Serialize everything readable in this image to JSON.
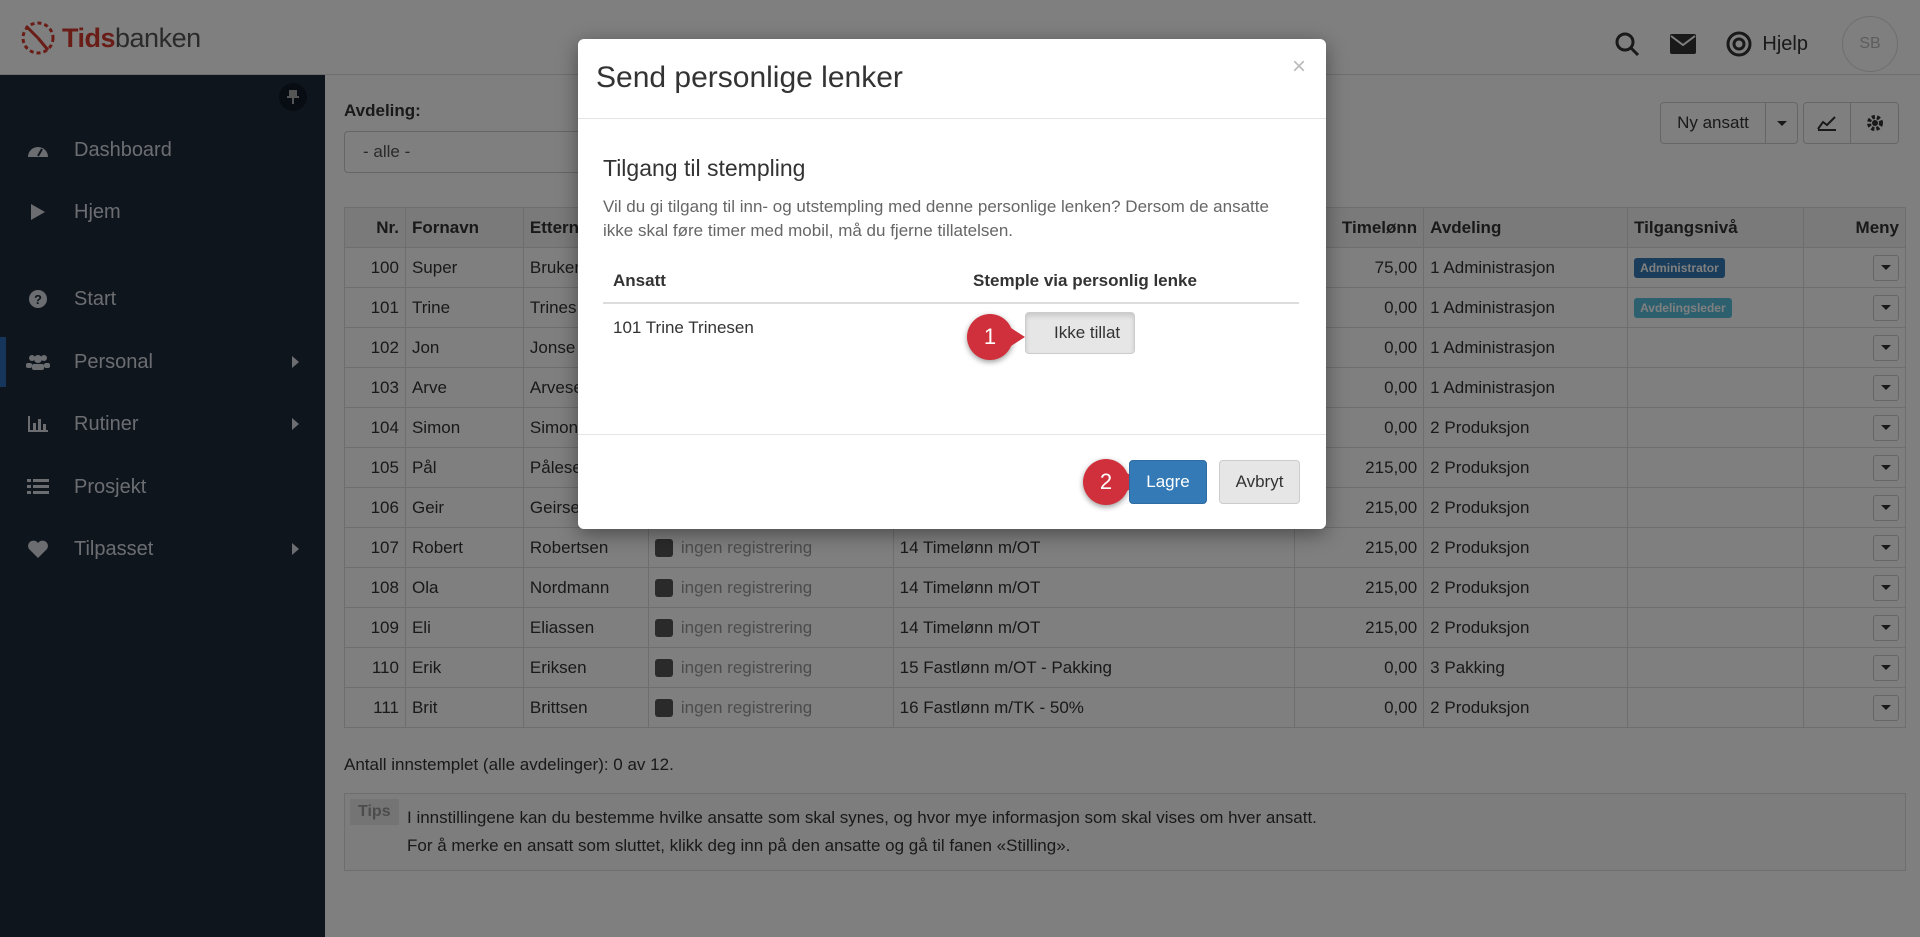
{
  "brand": {
    "name_part1": "Tids",
    "name_part2": "banken"
  },
  "topbar": {
    "help_label": "Hjelp",
    "avatar_initials": "SB"
  },
  "sidebar": {
    "items": [
      {
        "label": "Dashboard",
        "icon": "dashboard-icon"
      },
      {
        "label": "Hjem",
        "icon": "play-icon"
      },
      {
        "label": "Start",
        "icon": "question-icon"
      },
      {
        "label": "Personal",
        "icon": "users-icon"
      },
      {
        "label": "Rutiner",
        "icon": "bar-chart-icon"
      },
      {
        "label": "Prosjekt",
        "icon": "list-icon"
      },
      {
        "label": "Tilpasset",
        "icon": "heart-icon"
      }
    ]
  },
  "filter": {
    "label": "Avdeling:",
    "value": "- alle -"
  },
  "toolbar": {
    "new_employee": "Ny ansatt"
  },
  "table": {
    "headers": [
      "Nr.",
      "Fornavn",
      "Ettern",
      "",
      "",
      "Timelønn",
      "Avdeling",
      "Tilgangsnivå",
      "Meny"
    ],
    "rows": [
      {
        "nr": "100",
        "first": "Super",
        "last": "Bruker",
        "status": "",
        "wage_type": "",
        "wage": "75,00",
        "dept": "1 Administrasjon",
        "access": "Administrator"
      },
      {
        "nr": "101",
        "first": "Trine",
        "last": "Trines",
        "status": "",
        "wage_type": "",
        "wage": "0,00",
        "dept": "1 Administrasjon",
        "access": "Avdelingsleder"
      },
      {
        "nr": "102",
        "first": "Jon",
        "last": "Jonse",
        "status": "",
        "wage_type": "",
        "wage": "0,00",
        "dept": "1 Administrasjon",
        "access": ""
      },
      {
        "nr": "103",
        "first": "Arve",
        "last": "Arvese",
        "status": "",
        "wage_type": "",
        "wage": "0,00",
        "dept": "1 Administrasjon",
        "access": ""
      },
      {
        "nr": "104",
        "first": "Simon",
        "last": "Simon",
        "status": "",
        "wage_type": "",
        "wage": "0,00",
        "dept": "2 Produksjon",
        "access": ""
      },
      {
        "nr": "105",
        "first": "Pål",
        "last": "Pålese",
        "status": "",
        "wage_type": "",
        "wage": "215,00",
        "dept": "2 Produksjon",
        "access": ""
      },
      {
        "nr": "106",
        "first": "Geir",
        "last": "Geirse",
        "status": "",
        "wage_type": "",
        "wage": "215,00",
        "dept": "2 Produksjon",
        "access": ""
      },
      {
        "nr": "107",
        "first": "Robert",
        "last": "Robertsen",
        "status": "ingen registrering",
        "wage_type": "14 Timelønn m/OT",
        "wage": "215,00",
        "dept": "2 Produksjon",
        "access": ""
      },
      {
        "nr": "108",
        "first": "Ola",
        "last": "Nordmann",
        "status": "ingen registrering",
        "wage_type": "14 Timelønn m/OT",
        "wage": "215,00",
        "dept": "2 Produksjon",
        "access": ""
      },
      {
        "nr": "109",
        "first": "Eli",
        "last": "Eliassen",
        "status": "ingen registrering",
        "wage_type": "14 Timelønn m/OT",
        "wage": "215,00",
        "dept": "2 Produksjon",
        "access": ""
      },
      {
        "nr": "110",
        "first": "Erik",
        "last": "Eriksen",
        "status": "ingen registrering",
        "wage_type": "15 Fastlønn m/OT - Pakking",
        "wage": "0,00",
        "dept": "3 Pakking",
        "access": ""
      },
      {
        "nr": "111",
        "first": "Brit",
        "last": "Brittsen",
        "status": "ingen registrering",
        "wage_type": "16 Fastlønn m/TK - 50%",
        "wage": "0,00",
        "dept": "2 Produksjon",
        "access": ""
      }
    ]
  },
  "summary": "Antall innstemplet (alle avdelinger): 0 av 12.",
  "tips": {
    "label": "Tips",
    "line1": "I innstillingene kan du bestemme hvilke ansatte som skal synes, og hvor mye informasjon som skal vises om hver ansatt.",
    "line2": "For å merke en ansatt som sluttet, klikk deg inn på den ansatte og gå til fanen «Stilling»."
  },
  "modal": {
    "title": "Send personlige lenker",
    "close": "×",
    "subtitle": "Tilgang til stempling",
    "description": "Vil du gi tilgang til inn- og utstempling med denne personlige lenken? Dersom de ansatte ikke skal føre timer med mobil, må du fjerne tillatelsen.",
    "col_employee": "Ansatt",
    "col_stamp": "Stemple via personlig lenke",
    "employee": "101 Trine Trinesen",
    "toggle_label": "Ikke tillat",
    "save": "Lagre",
    "cancel": "Avbryt",
    "marker1": "1",
    "marker2": "2"
  },
  "colors": {
    "sidebar": "#1f2a3b",
    "primary": "#337ab7",
    "brand_red": "#d33a2c",
    "marker": "#d0303b"
  }
}
